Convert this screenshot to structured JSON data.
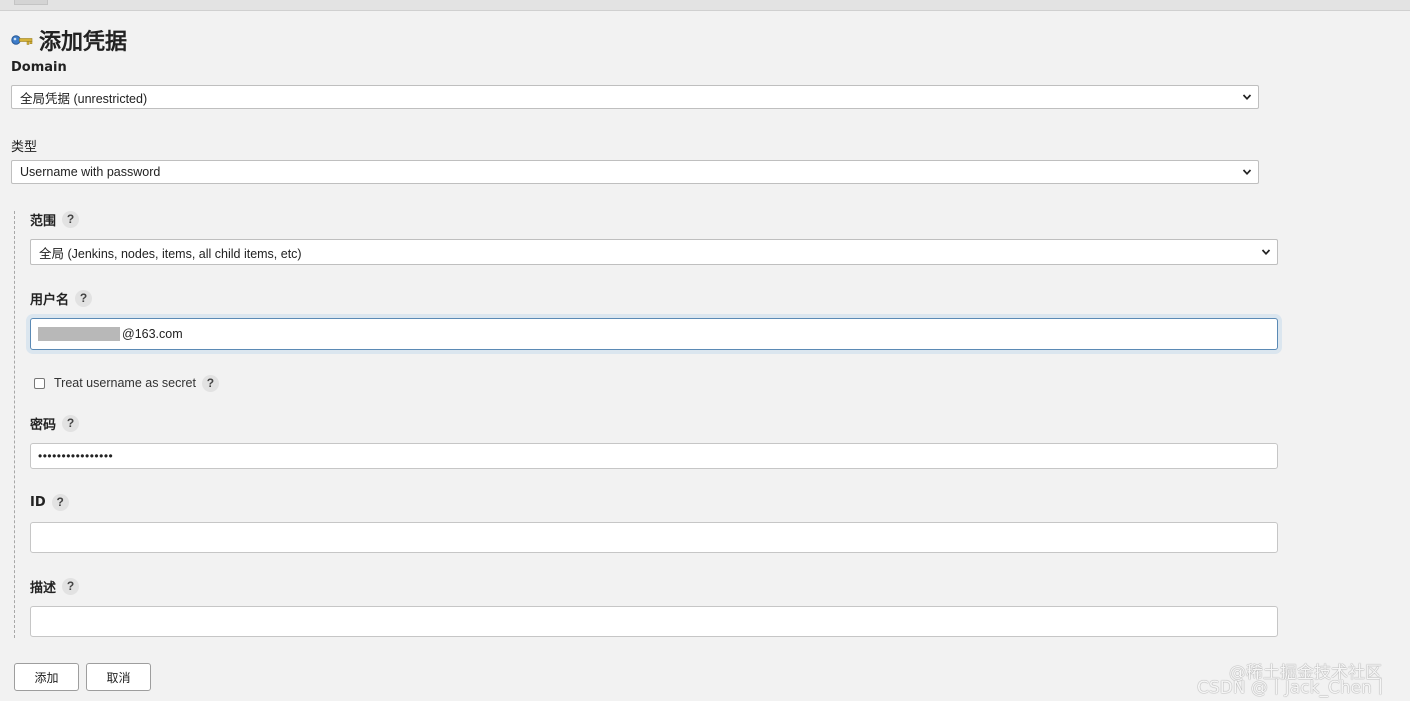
{
  "page": {
    "title": "添加凭据"
  },
  "domain": {
    "label": "Domain",
    "selected": "全局凭据 (unrestricted)"
  },
  "kind": {
    "label": "类型",
    "selected": "Username with password"
  },
  "scope": {
    "label": "范围",
    "help": "?",
    "selected": "全局 (Jenkins, nodes, items, all child items, etc)"
  },
  "username": {
    "label": "用户名",
    "help": "?",
    "value_suffix": "@163.com"
  },
  "username_secret": {
    "label": "Treat username as secret",
    "help": "?",
    "checked": false
  },
  "password": {
    "label": "密码",
    "help": "?",
    "value": "••••••••••••••••"
  },
  "id": {
    "label": "ID",
    "help": "?",
    "value": ""
  },
  "description": {
    "label": "描述",
    "help": "?",
    "value": ""
  },
  "actions": {
    "add_label": "添加",
    "cancel_label": "取消"
  },
  "watermark": {
    "line1": "@稀土掘金技术社区",
    "line2": "CSDN @丨Jack_Chen丨"
  },
  "icons": {
    "title_icon": "key-icon",
    "select_arrow": "chevron-down-icon",
    "help": "help-icon"
  }
}
